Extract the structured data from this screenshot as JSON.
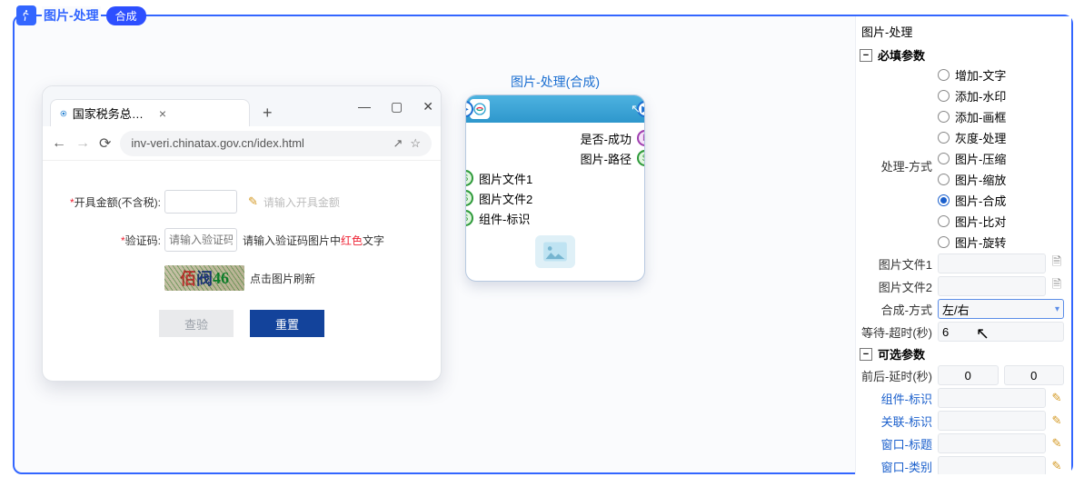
{
  "title": "图片-处理",
  "title_pill": "合成",
  "browser": {
    "tab_title": "国家税务总局全国增值税发票查验",
    "url": "inv-veri.chinatax.gov.cn/idex.html",
    "form": {
      "amount_label": "开具金额(不含税):",
      "amount_hint": "请输入开具金额",
      "captcha_label": "验证码:",
      "captcha_placeholder": "请输入验证码",
      "captcha_hint_pre": "请输入验证码图片中",
      "captcha_hint_red": "红色",
      "captcha_hint_post": "文字",
      "captcha_refresh": "点击图片刷新",
      "btn_check": "查验",
      "btn_reset": "重置"
    }
  },
  "node": {
    "title": "图片-处理(合成)",
    "outputs": [
      {
        "label": "是否-成功",
        "pin": "b"
      },
      {
        "label": "图片-路径",
        "pin": "S"
      }
    ],
    "inputs": [
      {
        "label": "图片文件1",
        "pin": "S"
      },
      {
        "label": "图片文件2",
        "pin": "S"
      },
      {
        "label": "组件-标识",
        "pin": "S"
      }
    ]
  },
  "panel": {
    "title": "图片-处理",
    "required_section": "必填参数",
    "optional_section": "可选参数",
    "proc_mode_label": "处理-方式",
    "proc_mode_options": [
      {
        "label": "增加-文字",
        "checked": false
      },
      {
        "label": "添加-水印",
        "checked": false
      },
      {
        "label": "添加-画框",
        "checked": false
      },
      {
        "label": "灰度-处理",
        "checked": false
      },
      {
        "label": "图片-压缩",
        "checked": false
      },
      {
        "label": "图片-缩放",
        "checked": false
      },
      {
        "label": "图片-合成",
        "checked": true
      },
      {
        "label": "图片-比对",
        "checked": false
      },
      {
        "label": "图片-旋转",
        "checked": false
      }
    ],
    "file1_label": "图片文件1",
    "file2_label": "图片文件2",
    "merge_mode_label": "合成-方式",
    "merge_mode_value": "左/右",
    "wait_timeout_label": "等待-超时(秒)",
    "wait_timeout_value": "6",
    "delay_label": "前后-延时(秒)",
    "delay_before": "0",
    "delay_after": "0",
    "comp_id_label": "组件-标识",
    "rel_id_label": "关联-标识",
    "win_title_label": "窗口-标题",
    "win_class_label": "窗口-类别"
  }
}
